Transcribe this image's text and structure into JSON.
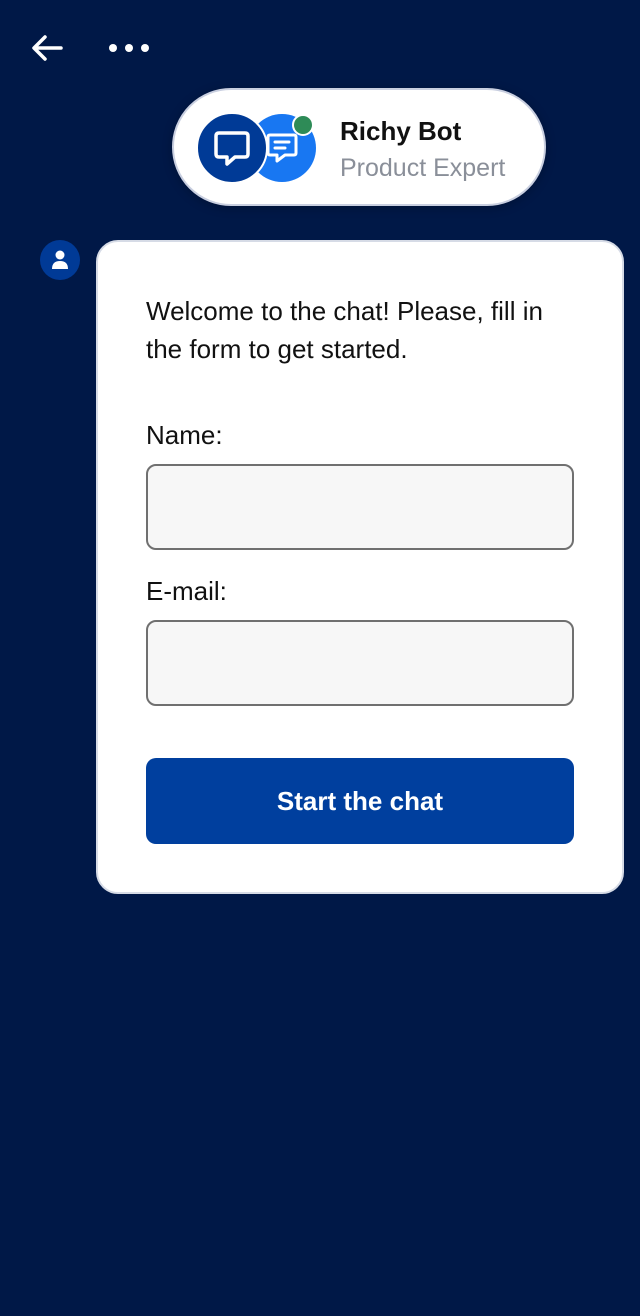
{
  "header": {
    "back_icon": "arrow-left-icon",
    "menu_icon": "more-horizontal-icon"
  },
  "agent": {
    "name": "Richy Bot",
    "role": "Product Expert",
    "status": "online",
    "status_color": "#2e8b57",
    "avatar_front_color": "#003a96",
    "avatar_back_color": "#1877f2",
    "avatar_icon": "chat-bubble-icon"
  },
  "message": {
    "avatar_icon": "user-icon",
    "welcome_text": "Welcome to the chat! Please, fill in the form to get started."
  },
  "form": {
    "name_label": "Name:",
    "name_value": "",
    "email_label": "E-mail:",
    "email_value": "",
    "submit_label": "Start the chat"
  },
  "colors": {
    "background": "#001847",
    "accent": "#003f9e"
  }
}
